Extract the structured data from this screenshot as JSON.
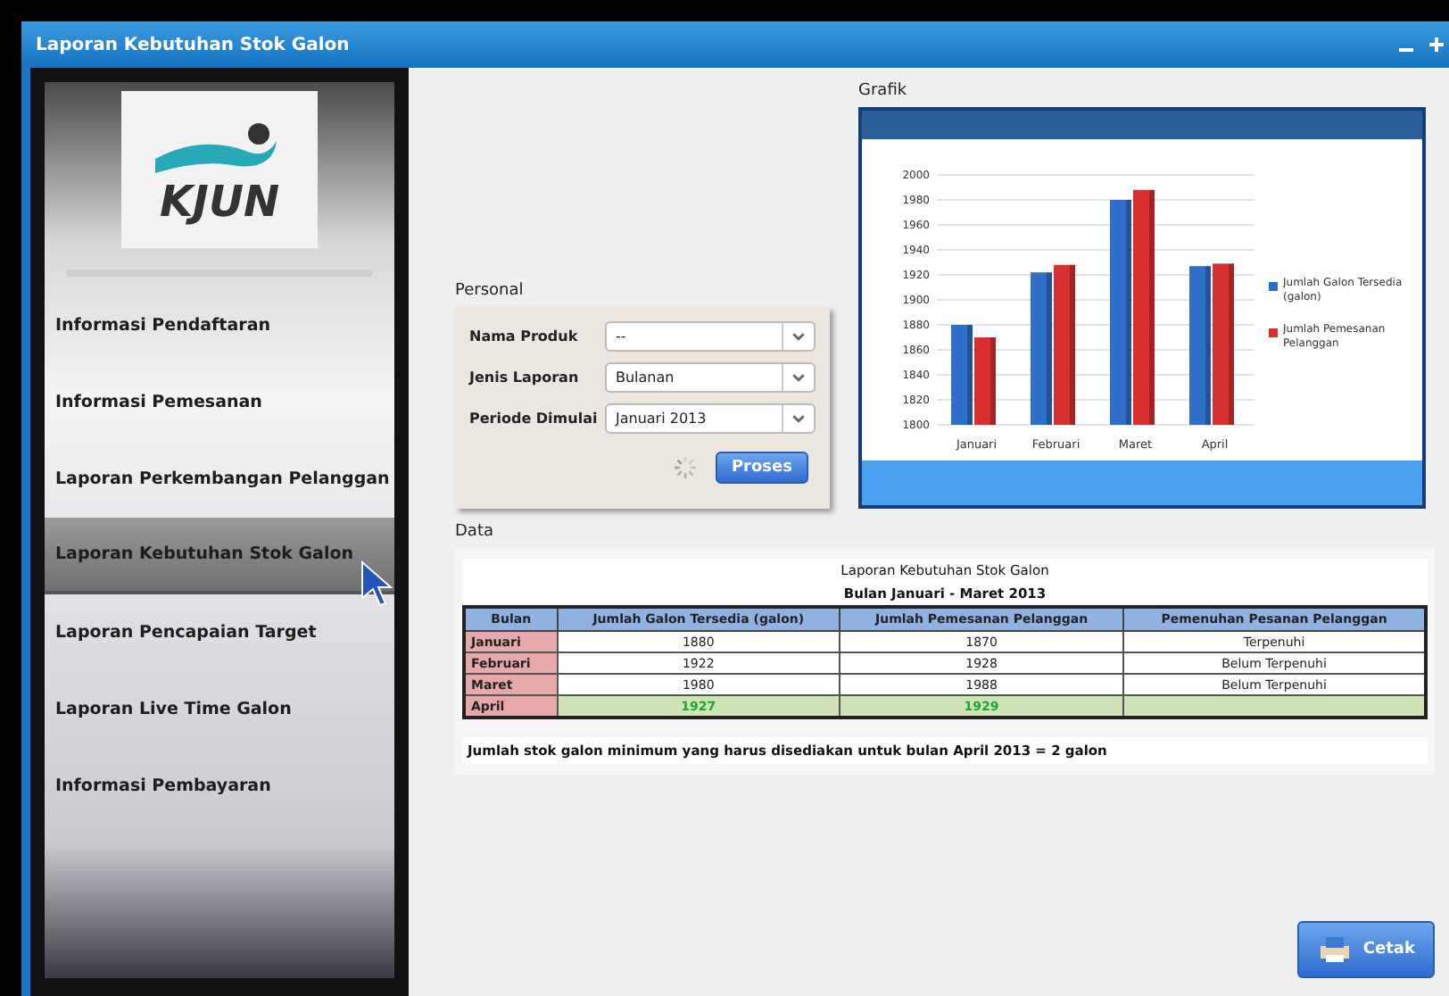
{
  "window": {
    "title": "Laporan Kebutuhan Stok Galon"
  },
  "logo": {
    "text": "KJUN"
  },
  "sidebar": {
    "items": [
      {
        "label": "Informasi Pendaftaran",
        "selected": false
      },
      {
        "label": "Informasi Pemesanan",
        "selected": false
      },
      {
        "label": "Laporan Perkembangan Pelanggan",
        "selected": false
      },
      {
        "label": "Laporan Kebutuhan Stok Galon",
        "selected": true
      },
      {
        "label": "Laporan Pencapaian Target",
        "selected": false
      },
      {
        "label": "Laporan Live Time Galon",
        "selected": false
      },
      {
        "label": "Informasi Pembayaran",
        "selected": false
      }
    ]
  },
  "personal": {
    "title": "Personal",
    "fields": [
      {
        "label": "Nama Produk",
        "value": "--"
      },
      {
        "label": "Jenis Laporan",
        "value": "Bulanan"
      },
      {
        "label": "Periode Dimulai",
        "value": "Januari 2013"
      }
    ],
    "button": "Proses"
  },
  "grafik": {
    "title": "Grafik",
    "chart_data": {
      "type": "bar",
      "categories": [
        "Januari",
        "Februari",
        "Maret",
        "April"
      ],
      "series": [
        {
          "name": "Jumlah Galon Tersedia (galon)",
          "color": "#2f6fc8",
          "values": [
            1880,
            1922,
            1980,
            1927
          ]
        },
        {
          "name": "Jumlah Pemesanan Pelanggan",
          "color": "#d83030",
          "values": [
            1870,
            1928,
            1988,
            1929
          ]
        }
      ],
      "ylim": [
        1800,
        2000
      ],
      "grid": true,
      "legend": true,
      "yticks": [
        1800,
        1820,
        1840,
        1860,
        1880,
        1900,
        1920,
        1940,
        1960,
        1980,
        2000
      ]
    }
  },
  "data": {
    "title": "Data",
    "report_title": "Laporan Kebutuhan Stok Galon",
    "report_period": "Bulan Januari - Maret 2013",
    "columns": [
      "Bulan",
      "Jumlah Galon Tersedia (galon)",
      "Jumlah Pemesanan Pelanggan",
      "Pemenuhan Pesanan Pelanggan"
    ],
    "rows": [
      {
        "cells": [
          "Januari",
          "1880",
          "1870",
          "Terpenuhi"
        ],
        "highlight": false
      },
      {
        "cells": [
          "Februari",
          "1922",
          "1928",
          "Belum Terpenuhi"
        ],
        "highlight": false
      },
      {
        "cells": [
          "Maret",
          "1980",
          "1988",
          "Belum Terpenuhi"
        ],
        "highlight": false
      },
      {
        "cells": [
          "April",
          "1927",
          "1929"
        ],
        "highlight": true
      }
    ],
    "note": "Jumlah stok galon minimum yang harus disediakan untuk bulan April 2013 = 2 galon"
  },
  "print_button": "Cetak"
}
